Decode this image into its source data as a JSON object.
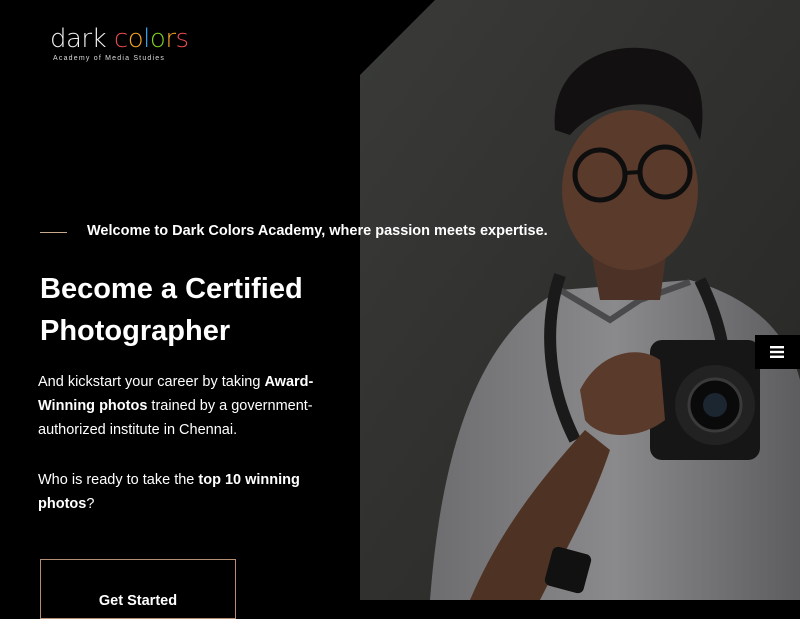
{
  "brand": {
    "logo_word_1": "dark",
    "logo_word_2_letters": [
      "c",
      "o",
      "l",
      "o",
      "r",
      "s"
    ],
    "tagline": "Academy of Media Studies"
  },
  "hero": {
    "welcome": "Welcome to Dark Colors Academy, where passion meets expertise.",
    "headline": "Become a Certified Photographer",
    "para1": {
      "before": "And kickstart your career by taking ",
      "bold": "Award-Winning photos",
      "after": " trained by a government-authorized institute in Chennai."
    },
    "para2": {
      "before": "Who is ready to take the ",
      "bold": "top 10 winning photos",
      "after": "?"
    },
    "cta_label": "Get Started"
  },
  "menu": {
    "icon": "hamburger-icon"
  },
  "colors": {
    "background": "#000000",
    "accent_line": "#c9a98a",
    "button_border": "#b38e72",
    "photo_backdrop": "#3a3a3a"
  }
}
